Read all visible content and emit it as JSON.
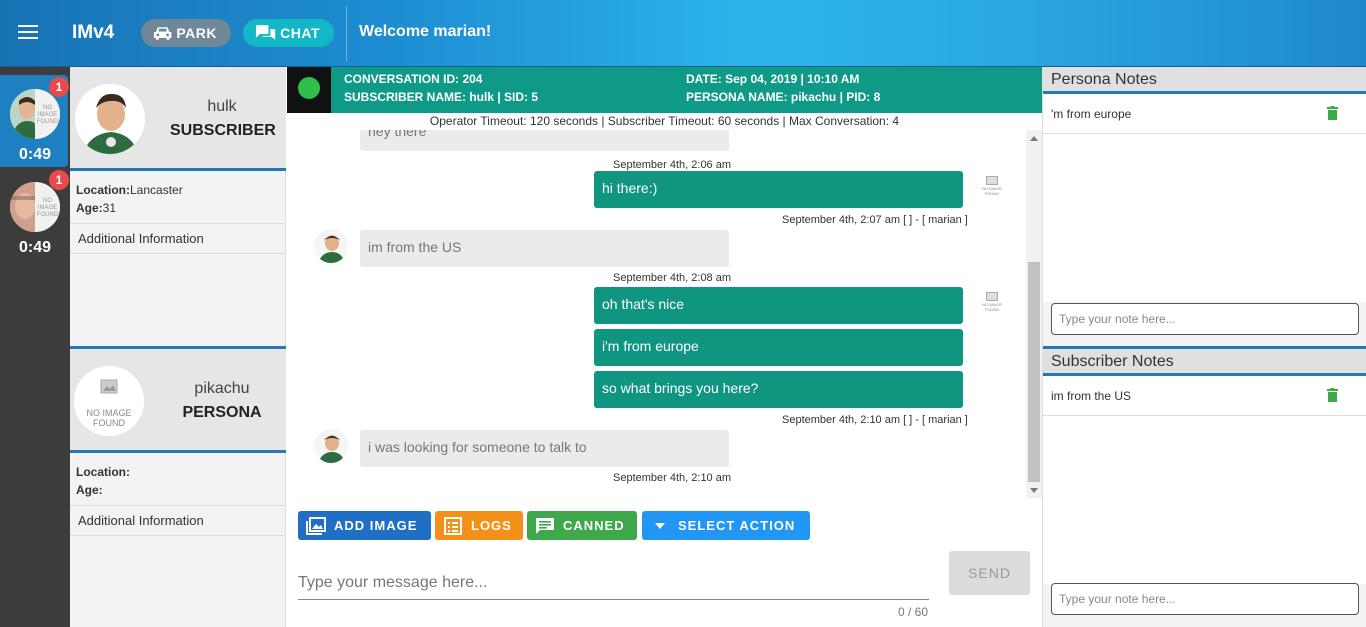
{
  "header": {
    "app_title": "IMv4",
    "park_label": "PARK",
    "chat_label": "CHAT",
    "welcome": "Welcome marian!"
  },
  "rail": {
    "items": [
      {
        "badge": "1",
        "timer": "0:49",
        "active": true
      },
      {
        "badge": "1",
        "timer": "0:49",
        "active": false
      }
    ],
    "no_image_text": "NO IMAGE FOUND"
  },
  "subscriber": {
    "name": "hulk",
    "role": "SUBSCRIBER",
    "location_label": "Location:",
    "location": "Lancaster",
    "age_label": "Age:",
    "age": "31",
    "additional": "Additional Information"
  },
  "persona": {
    "name": "pikachu",
    "role": "PERSONA",
    "location_label": "Location:",
    "location": "",
    "age_label": "Age:",
    "age": "",
    "additional": "Additional Information",
    "no_image_text": "NO IMAGE FOUND"
  },
  "conversation": {
    "id_line": "CONVERSATION ID: 204",
    "subscriber_line": "SUBSCRIBER NAME: hulk | SID: 5",
    "date_line": "DATE: Sep 04, 2019 | 10:10 AM",
    "persona_line": "PERSONA NAME: pikachu | PID: 8",
    "timeouts": "Operator Timeout: 120 seconds | Subscriber Timeout: 60 seconds | Max Conversation: 4",
    "status_color": "#2ec04a"
  },
  "messages": {
    "m0_text": "hey there",
    "m0_time": "September 4th, 2:06 am",
    "m1_text": "hi there:)",
    "m1_time": "September 4th, 2:07 am [ ] - [ marian ]",
    "m2_text": "im from the US",
    "m2_time": "September 4th, 2:08 am",
    "m3_text": "oh that's nice",
    "m4_text": "i'm from europe",
    "m5_text": "so what brings you here?",
    "m5_time": "September 4th, 2:10 am [ ] - [ marian ]",
    "m6_text": "i was looking for someone to talk to",
    "m6_time": "September 4th, 2:10 am",
    "no_image_text": "NO IMAGE FOUND"
  },
  "actions": {
    "add_image": "ADD IMAGE",
    "logs": "LOGS",
    "canned": "CANNED",
    "select_action": "SELECT ACTION",
    "send": "SEND",
    "input_placeholder": "Type your message here...",
    "counter": "0 / 60"
  },
  "notes": {
    "persona_title": "Persona Notes",
    "persona_item": "'m from europe",
    "persona_placeholder": "Type your note here...",
    "subscriber_title": "Subscriber Notes",
    "subscriber_item": "im from the US",
    "subscriber_placeholder": "Type your note here..."
  },
  "colors": {
    "header_blue": "#1e8fd3",
    "teal": "#0f9a87",
    "add_image_btn": "#1f6fc5",
    "logs_btn": "#f39019",
    "canned_btn": "#3ea84a",
    "select_action_btn": "#2196f3",
    "badge": "#e84b4b",
    "trash": "#3ea84a"
  }
}
